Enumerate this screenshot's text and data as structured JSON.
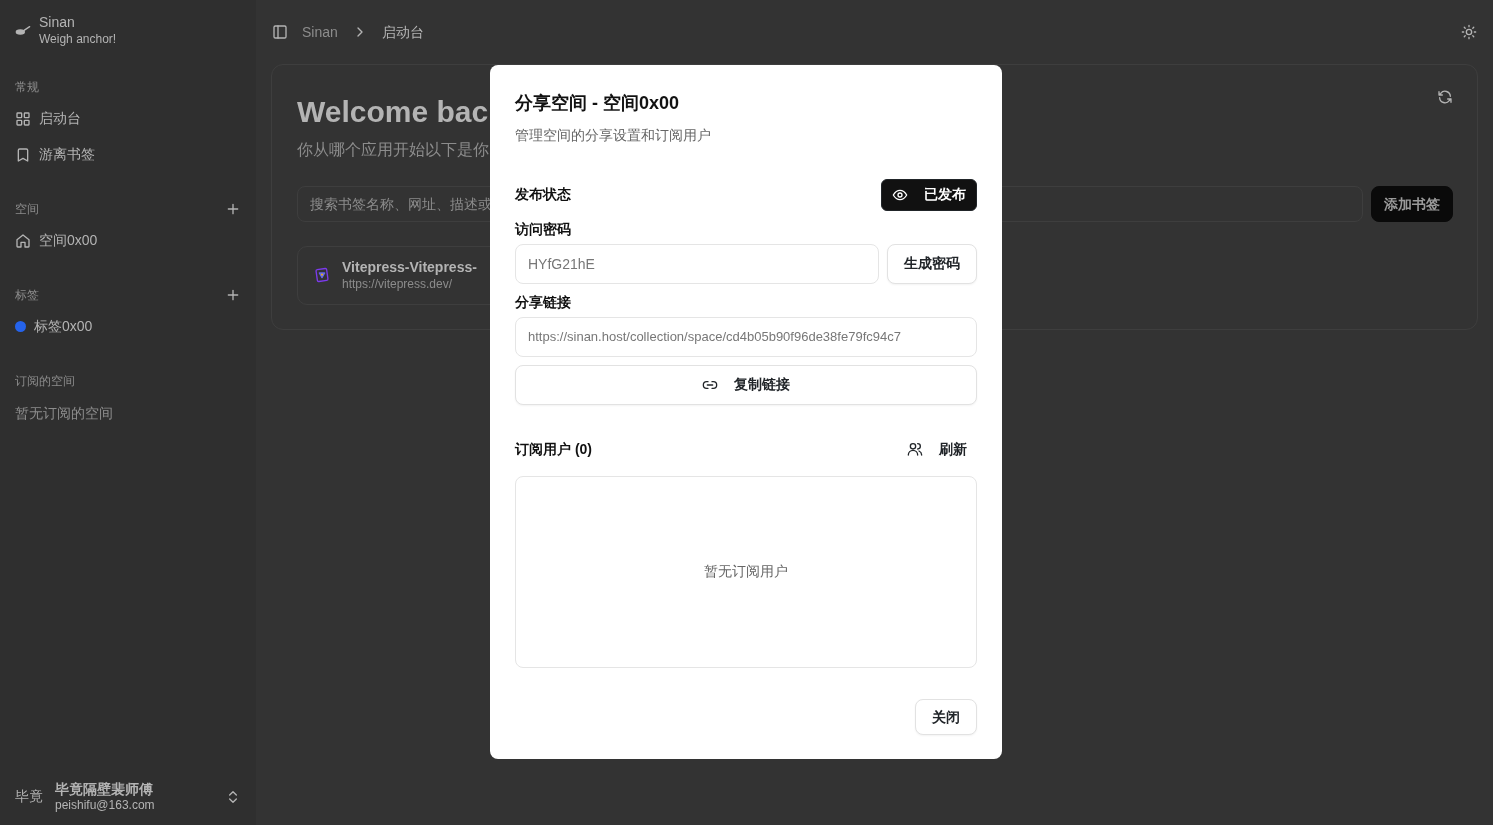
{
  "sidebar": {
    "brand": {
      "title": "Sinan",
      "subtitle": "Weigh anchor!"
    },
    "groups": [
      {
        "title": "常规",
        "addable": false,
        "items": [
          {
            "label": "启动台",
            "kind": "grid"
          },
          {
            "label": "游离书签",
            "kind": "bookmark"
          }
        ]
      },
      {
        "title": "空间",
        "addable": true,
        "items": [
          {
            "label": "空间0x00",
            "kind": "home"
          }
        ]
      },
      {
        "title": "标签",
        "addable": true,
        "items": [
          {
            "label": "标签0x00",
            "kind": "tag",
            "color": "#2563eb"
          }
        ]
      },
      {
        "title": "订阅的空间",
        "addable": false,
        "empty": "暂无订阅的空间"
      }
    ],
    "user": {
      "avatar": "毕竟",
      "name": "毕竟隔壁裴师傅",
      "email": "peishifu@163.com"
    }
  },
  "header": {
    "breadcrumb": [
      "Sinan",
      "启动台"
    ]
  },
  "main": {
    "title": "Welcome bac",
    "subtitle": "你从哪个应用开始以下是你",
    "search": {
      "placeholder": "搜索书签名称、网址、描述或"
    },
    "add_button": "添加书签",
    "bookmarks": [
      {
        "title": "Vitepress-Vitepress-",
        "url": "https://vitepress.dev/"
      }
    ]
  },
  "dialog": {
    "title": "分享空间 - 空间0x00",
    "description": "管理空间的分享设置和订阅用户",
    "publish": {
      "label": "发布状态",
      "button": "已发布",
      "published": true
    },
    "password": {
      "label": "访问密码",
      "value": "HYfG21hE",
      "button": "生成密码"
    },
    "link": {
      "label": "分享链接",
      "value": "https://sinan.host/collection/space/cd4b05b90f96de38fe79fc94c7",
      "button": "复制链接"
    },
    "subscribers": {
      "title": "订阅用户 (0)",
      "refresh": "刷新",
      "empty": "暂无订阅用户"
    },
    "close": "关闭"
  }
}
